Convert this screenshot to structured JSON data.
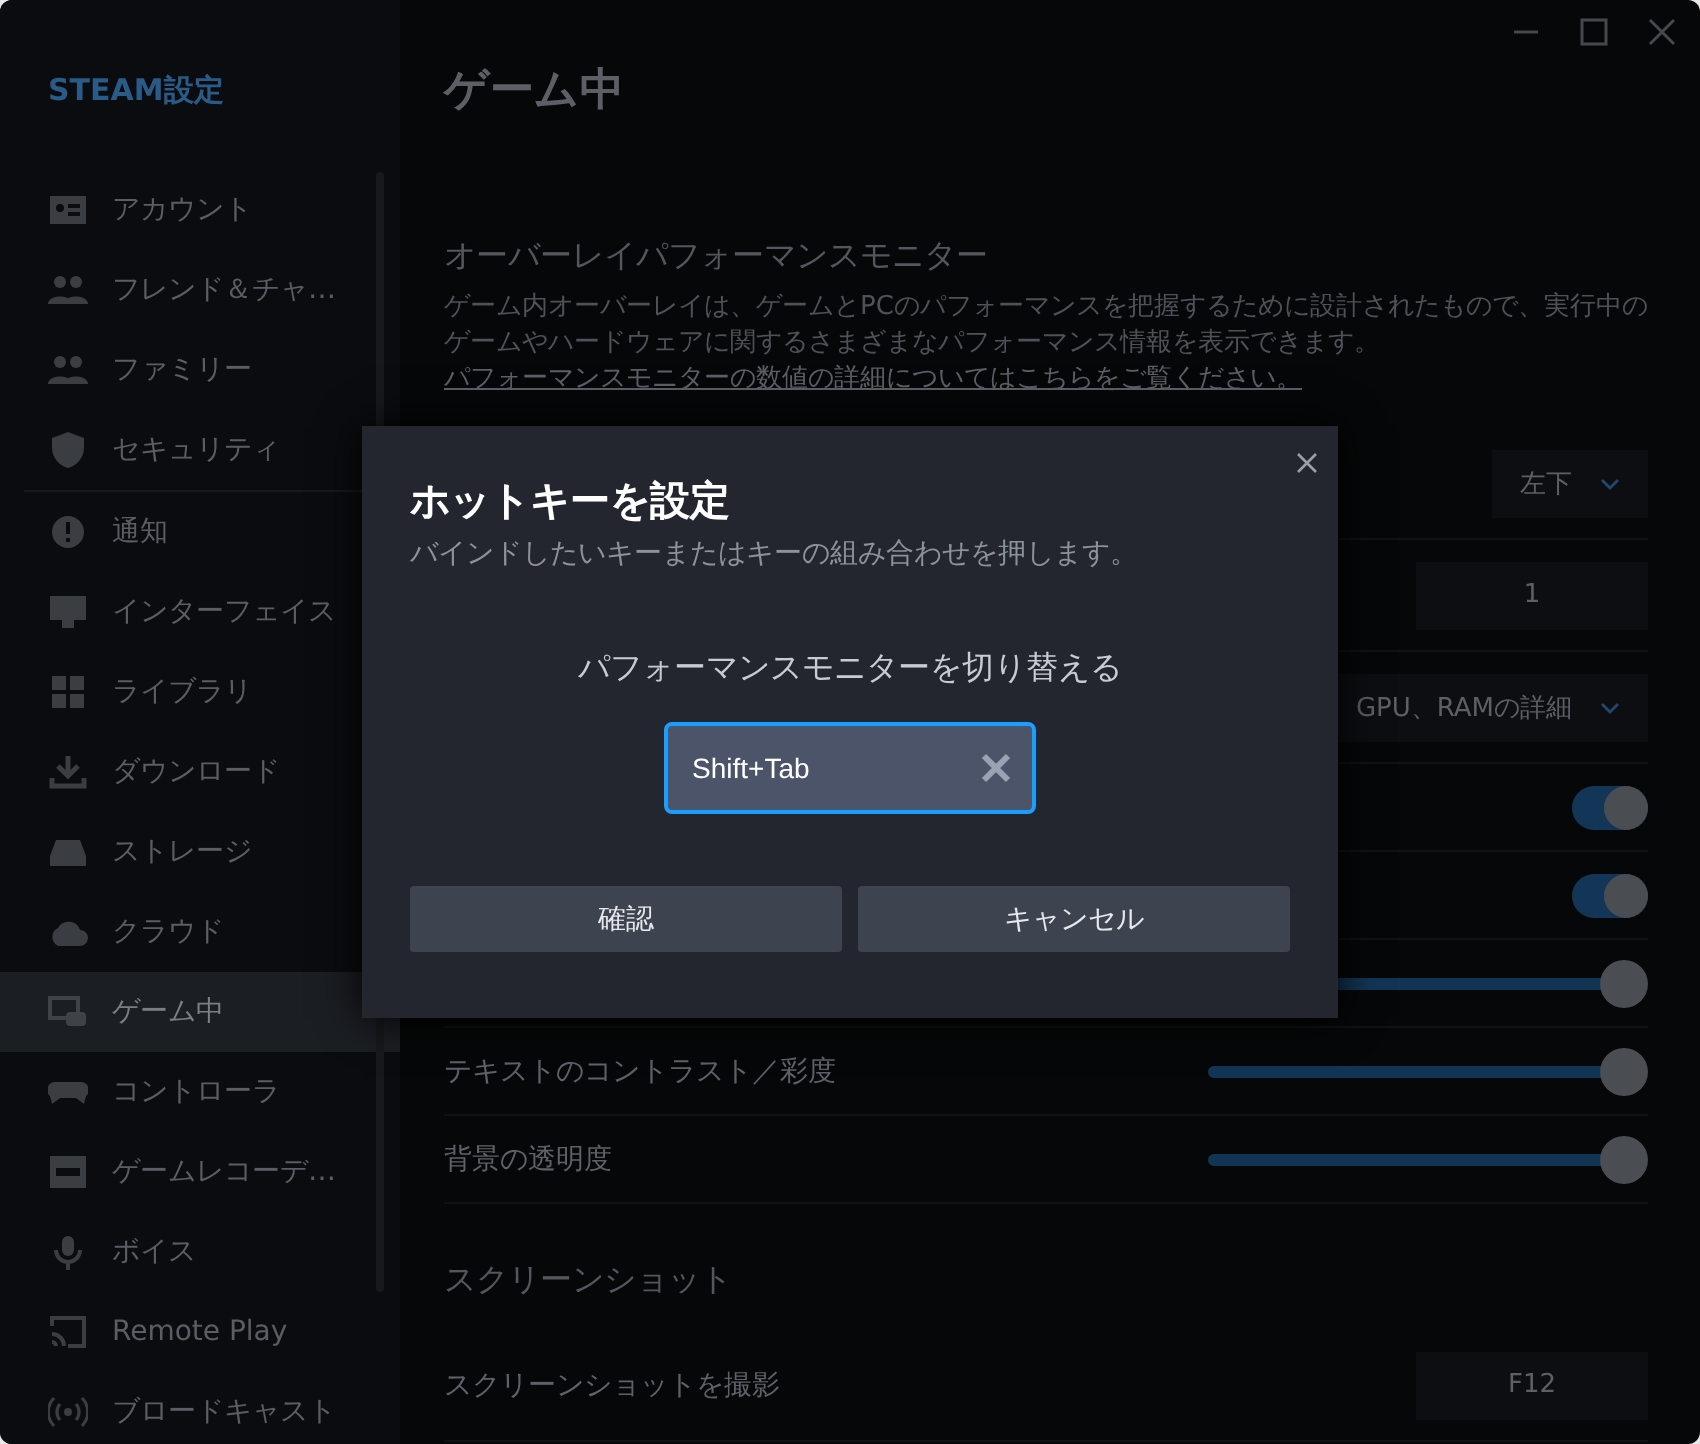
{
  "sidebar": {
    "title": "STEAM設定",
    "groups": [
      [
        {
          "label": "アカウント",
          "selected": false
        },
        {
          "label": "フレンド＆チャ…",
          "selected": false
        },
        {
          "label": "ファミリー",
          "selected": false
        },
        {
          "label": "セキュリティ",
          "selected": false
        }
      ],
      [
        {
          "label": "通知",
          "selected": false
        },
        {
          "label": "インターフェイス",
          "selected": false
        },
        {
          "label": "ライブラリ",
          "selected": false
        },
        {
          "label": "ダウンロード",
          "selected": false
        },
        {
          "label": "ストレージ",
          "selected": false
        },
        {
          "label": "クラウド",
          "selected": false
        },
        {
          "label": "ゲーム中",
          "selected": true
        },
        {
          "label": "コントローラ",
          "selected": false
        },
        {
          "label": "ゲームレコーデ…",
          "selected": false
        },
        {
          "label": "ボイス",
          "selected": false
        },
        {
          "label": "Remote Play",
          "selected": false
        },
        {
          "label": "ブロードキャスト",
          "selected": false
        }
      ]
    ]
  },
  "page": {
    "title": "ゲーム中",
    "section": "オーバーレイパフォーマンスモニター",
    "description": "ゲーム内オーバーレイは、ゲームとPCのパフォーマンスを把握するために設計されたもので、実行中のゲームやハードウェアに関するさまざまなパフォーマンス情報を表示できます。",
    "link": "パフォーマンスモニターの数値の詳細についてはこちらをご覧ください。",
    "rows": [
      {
        "kind": "dropdown",
        "value": "左下"
      },
      {
        "kind": "value",
        "value": "1"
      },
      {
        "kind": "dropdown",
        "value": "GPU、RAMの詳細"
      },
      {
        "kind": "toggle",
        "on": true
      },
      {
        "kind": "toggle",
        "on": true
      },
      {
        "kind": "slider",
        "level": 1
      },
      {
        "kind": "slider",
        "label": "テキストのコントラスト／彩度",
        "level": 1
      },
      {
        "kind": "slider",
        "label": "背景の透明度",
        "level": 1
      }
    ],
    "section2": "スクリーンショット",
    "rows2": [
      {
        "kind": "value",
        "label": "スクリーンショットを撮影",
        "value": "F12"
      }
    ]
  },
  "dialog": {
    "title": "ホットキーを設定",
    "subtitle": "バインドしたいキーまたはキーの組み合わせを押します。",
    "action": "パフォーマンスモニターを切り替える",
    "key": "Shift+Tab",
    "buttons": [
      "確認",
      "キャンセル"
    ]
  }
}
